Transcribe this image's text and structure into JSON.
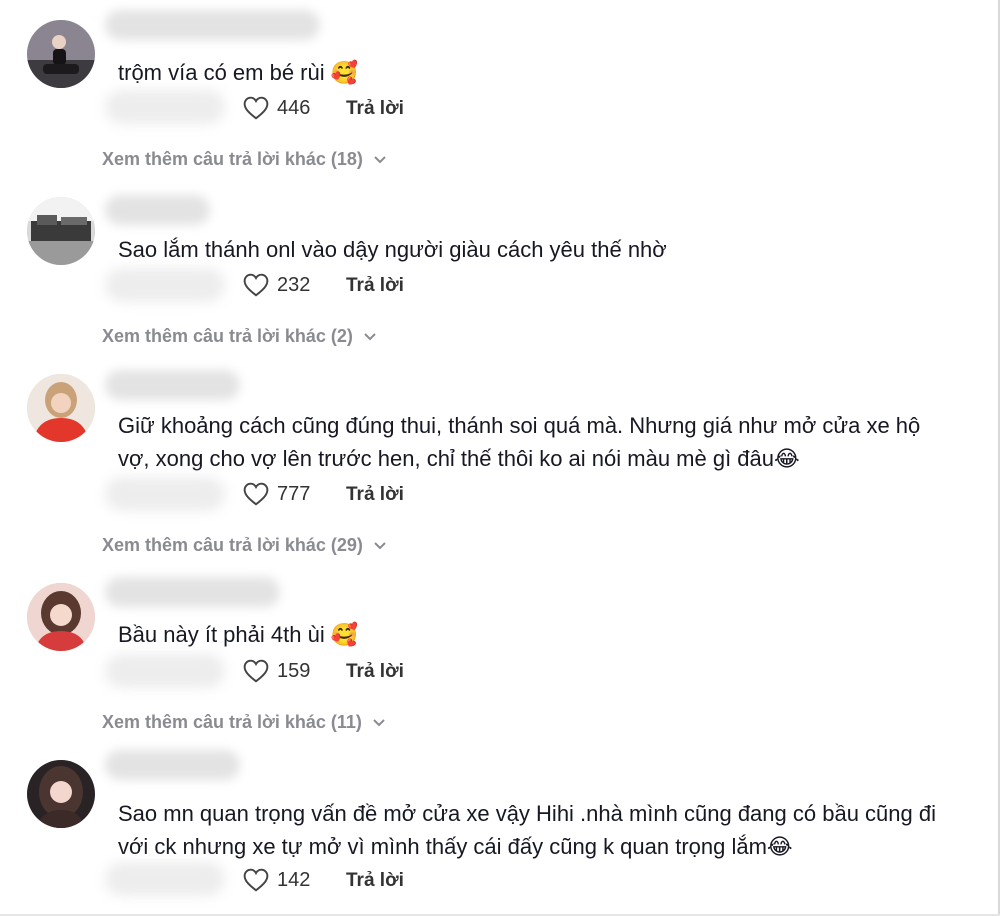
{
  "colors": {
    "text": "#161823",
    "muted": "#8a8b91",
    "action": "#333333",
    "heart_stroke": "#444444"
  },
  "reply_label": "Trả lời",
  "comments": [
    {
      "text": "trộm vía có em bé rùi 🥰",
      "likes": "446",
      "more_replies": "Xem thêm câu trả lời khác (18)",
      "avatar_icon": "user-avatar-icon"
    },
    {
      "text": "Sao lắm thánh onl vào dậy người giàu cách yêu thế nhờ",
      "likes": "232",
      "more_replies": "Xem thêm câu trả lời khác (2)",
      "avatar_icon": "user-avatar-icon"
    },
    {
      "text": "Giữ khoảng cách cũng đúng thui, thánh soi quá mà. Nhưng giá như mở cửa xe hộ vợ, xong cho vợ lên trước hen, chỉ thế thôi ko ai nói màu mè gì đâu😂",
      "likes": "777",
      "more_replies": "Xem thêm câu trả lời khác (29)",
      "avatar_icon": "user-avatar-icon"
    },
    {
      "text": "Bầu này ít phải 4th ùi 🥰",
      "likes": "159",
      "more_replies": "Xem thêm câu trả lời khác (11)",
      "avatar_icon": "user-avatar-icon"
    },
    {
      "text": "Sao mn quan trọng vấn đề mở cửa xe vậy Hihi .nhà mình cũng đang có bầu cũng đi với ck nhưng xe tự mở vì mình thấy cái đấy cũng k quan trọng lắm😂",
      "likes": "142",
      "more_replies": "",
      "avatar_icon": "user-avatar-icon"
    }
  ]
}
